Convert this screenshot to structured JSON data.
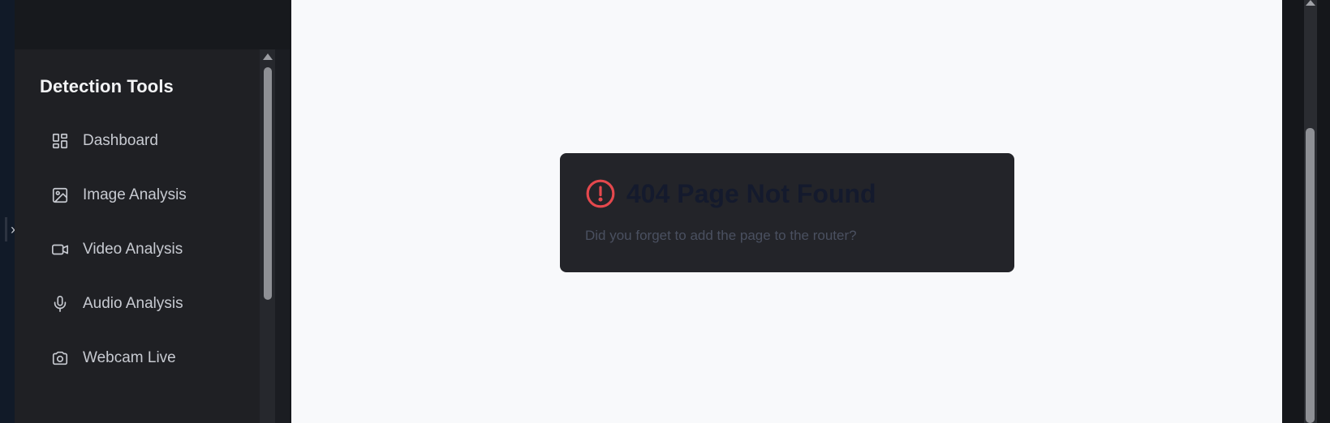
{
  "sidebar": {
    "section_title": "Detection Tools",
    "items": [
      {
        "label": "Dashboard",
        "icon": "dashboard-icon"
      },
      {
        "label": "Image Analysis",
        "icon": "image-icon"
      },
      {
        "label": "Video Analysis",
        "icon": "video-icon"
      },
      {
        "label": "Audio Analysis",
        "icon": "microphone-icon"
      },
      {
        "label": "Webcam Live",
        "icon": "camera-icon"
      }
    ],
    "collapse_glyph": "›"
  },
  "error": {
    "title": "404 Page Not Found",
    "message": "Did you forget to add the page to the router?",
    "icon": "alert-circle-icon",
    "accent_color": "#e5484d"
  },
  "colors": {
    "sidebar_bg": "#1f2024",
    "main_bg": "#f8f9fb",
    "card_bg": "#232429"
  }
}
